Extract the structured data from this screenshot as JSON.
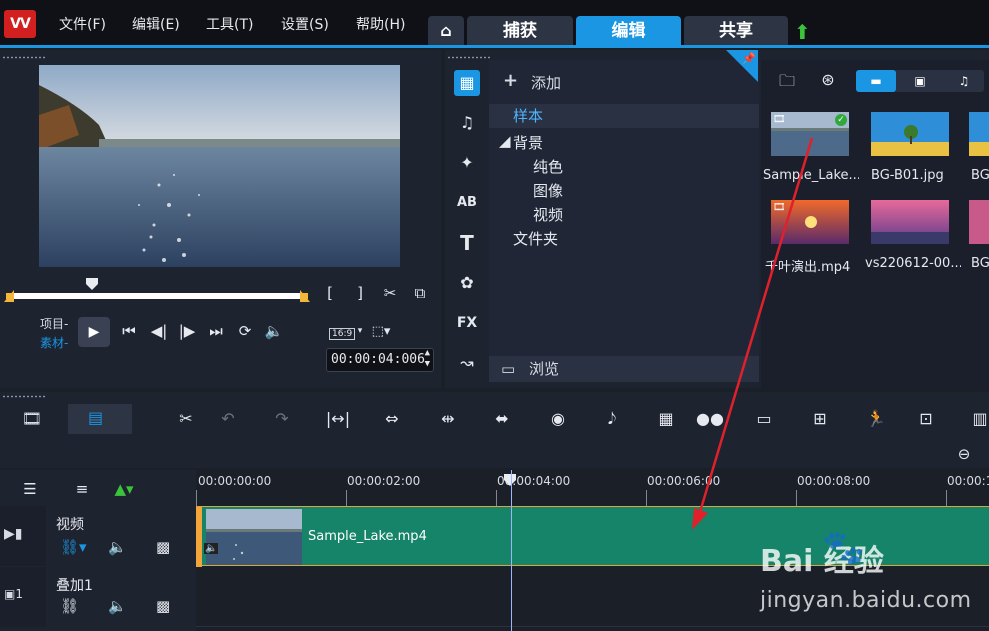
{
  "menu": {
    "logo": "VV",
    "items": [
      "文件(F)",
      "编辑(E)",
      "工具(T)",
      "设置(S)",
      "帮助(H)"
    ],
    "tabs": [
      "捕获",
      "编辑",
      "共享"
    ]
  },
  "player": {
    "mode_project": "项目-",
    "mode_clip": "素材-",
    "timecode": "00:00:04:006",
    "aspect": "16:9"
  },
  "library": {
    "add_label": "添加",
    "tree": [
      "样本",
      "背景",
      "纯色",
      "图像",
      "视频",
      "文件夹"
    ],
    "browse_label": "浏览",
    "thumbs": [
      {
        "label": "Sample_Lake..."
      },
      {
        "label": "BG-B01.jpg"
      },
      {
        "label": "BG"
      },
      {
        "label": "千叶演出.mp4"
      },
      {
        "label": "vs220612-00..."
      },
      {
        "label": "BG"
      }
    ]
  },
  "timeline": {
    "ticks": [
      "00:00:00:00",
      "00:00:02:00",
      "00:00:04:00",
      "00:00:06:00",
      "00:00:08:00",
      "00:00:1"
    ],
    "tracks": [
      {
        "name": "视频"
      },
      {
        "name": "叠加1"
      }
    ],
    "clip_name": "Sample_Lake.mp4"
  },
  "watermark": {
    "brand": "Bai 经验",
    "url": "jingyan.baidu.com"
  },
  "colors": {
    "accent": "#1b96e3",
    "clip": "#158469",
    "handle": "#f3a43a",
    "arrow": "#e0202a"
  }
}
